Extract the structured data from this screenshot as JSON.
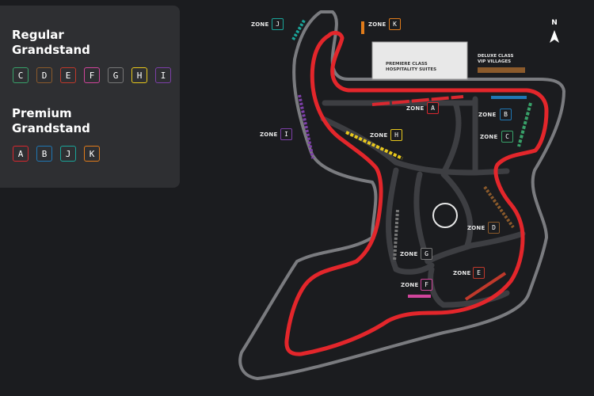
{
  "legend": {
    "regular": {
      "title_line1": "Regular",
      "title_line2": "Grandstand",
      "items": [
        {
          "label": "C",
          "color": "#38a169"
        },
        {
          "label": "D",
          "color": "#8b5a2b"
        },
        {
          "label": "E",
          "color": "#c0392b"
        },
        {
          "label": "F",
          "color": "#d0459b"
        },
        {
          "label": "G",
          "color": "#777777"
        },
        {
          "label": "H",
          "color": "#e8c81c"
        },
        {
          "label": "I",
          "color": "#7d3fa8"
        }
      ]
    },
    "premium": {
      "title_line1": "Premium",
      "title_line2": "Grandstand",
      "items": [
        {
          "label": "A",
          "color": "#d9282f"
        },
        {
          "label": "B",
          "color": "#1f77b4"
        },
        {
          "label": "J",
          "color": "#1aa59a"
        },
        {
          "label": "K",
          "color": "#e07b1a"
        }
      ]
    }
  },
  "zones": {
    "word": "ZONE",
    "J": "J",
    "K": "K",
    "A": "A",
    "B": "B",
    "C": "C",
    "H": "H",
    "I": "I",
    "D": "D",
    "G": "G",
    "E": "E",
    "F": "F"
  },
  "buildings": {
    "premiere_line1": "PREMIERE CLASS",
    "premiere_line2": "HOSPITALITY SUITES",
    "deluxe_line1": "DELUXE CLASS",
    "deluxe_line2": "VIP VILLAGES"
  },
  "compass": {
    "label": "N"
  },
  "colors": {
    "track": "#e3262b",
    "road": "#3d3e42",
    "outline": "#7a7b7f",
    "background": "#1b1c1f",
    "panel": "#2e2f32"
  }
}
